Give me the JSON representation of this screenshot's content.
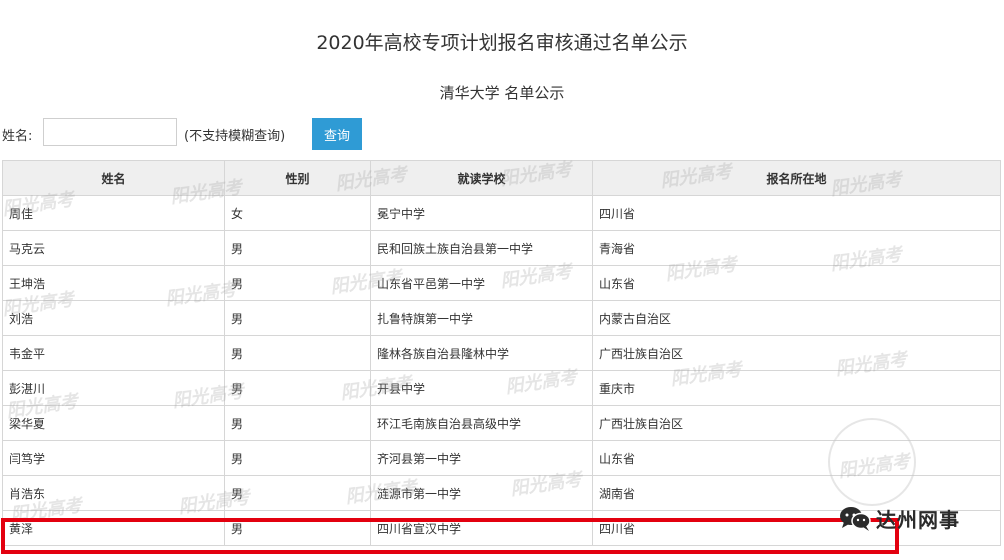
{
  "page": {
    "title": "2020年高校专项计划报名审核通过名单公示",
    "subtitle": "清华大学 名单公示"
  },
  "search": {
    "label": "姓名:",
    "input_value": "",
    "hint": "(不支持模糊查询)",
    "button_label": "查询"
  },
  "table": {
    "headers": [
      "姓名",
      "性别",
      "就读学校",
      "报名所在地"
    ],
    "rows": [
      [
        "周佳",
        "女",
        "冕宁中学",
        "四川省"
      ],
      [
        "马克云",
        "男",
        "民和回族土族自治县第一中学",
        "青海省"
      ],
      [
        "王坤浩",
        "男",
        "山东省平邑第一中学",
        "山东省"
      ],
      [
        "刘浩",
        "男",
        "扎鲁特旗第一中学",
        "内蒙古自治区"
      ],
      [
        "韦金平",
        "男",
        "隆林各族自治县隆林中学",
        "广西壮族自治区"
      ],
      [
        "彭湛川",
        "男",
        "开县中学",
        "重庆市"
      ],
      [
        "梁华夏",
        "男",
        "环江毛南族自治县高级中学",
        "广西壮族自治区"
      ],
      [
        "闫笃学",
        "男",
        "齐河县第一中学",
        "山东省"
      ],
      [
        "肖浩东",
        "男",
        "涟源市第一中学",
        "湖南省"
      ],
      [
        "黄泽",
        "男",
        "四川省宣汉中学",
        "四川省"
      ]
    ]
  },
  "watermark": {
    "text": "阳光高考"
  },
  "logo": {
    "text": "达州网事",
    "icon": "wechat-icon"
  },
  "colors": {
    "button": "#2f9bd5",
    "highlight": "#e3000f",
    "header_bg": "#efefef"
  }
}
